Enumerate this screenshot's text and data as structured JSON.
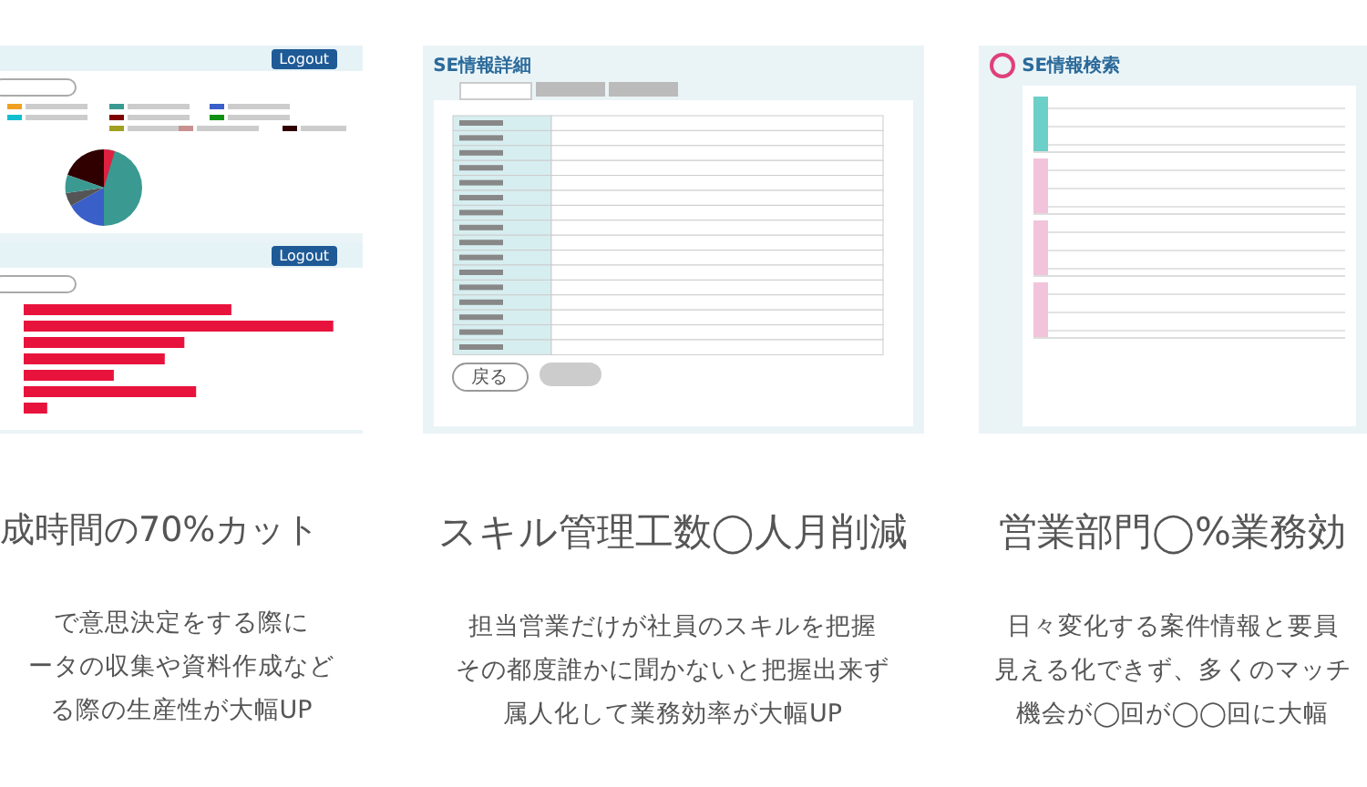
{
  "features": [
    {
      "heading": "成時間の70%カット",
      "lines": [
        "で意思決定をする際に",
        "ータの収集や資料作成など",
        "る際の生産性が大幅UP"
      ],
      "screenshot": {
        "kind": "charts",
        "panels": [
          {
            "logout": "Logout",
            "kind": "pie"
          },
          {
            "logout": "Logout",
            "kind": "bar"
          }
        ]
      }
    },
    {
      "heading": "スキル管理工数◯人月削減",
      "lines": [
        "担当営業だけが社員のスキルを把握",
        "その都度誰かに聞かないと把握出来ず",
        "属人化して業務効率が大幅UP"
      ],
      "screenshot": {
        "kind": "detail",
        "title": "SE情報詳細",
        "tabs": [
          {
            "selected": true
          },
          {
            "selected": false
          },
          {
            "selected": false
          }
        ],
        "back_button": "戻る"
      }
    },
    {
      "heading": "営業部門◯%業務効",
      "lines": [
        "日々変化する案件情報と要員",
        "見える化できず、多くのマッチ",
        "機会が◯回が◯◯回に大幅"
      ],
      "screenshot": {
        "kind": "list",
        "title": "SE情報検索",
        "rows": [
          {
            "color": "#6ccfc8"
          },
          {
            "color": "#f2c4dc"
          },
          {
            "color": "#f2c4dc"
          },
          {
            "color": "#f2c4dc"
          }
        ]
      }
    }
  ]
}
